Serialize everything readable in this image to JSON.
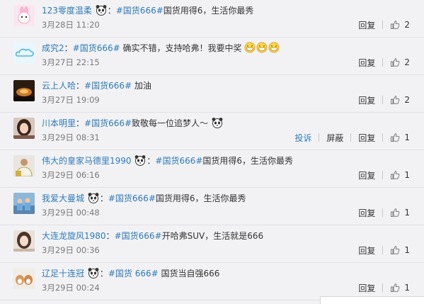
{
  "actions": {
    "reply": "回复",
    "report": "投诉",
    "block": "屏蔽"
  },
  "comments": [
    {
      "user": "123零度温柔",
      "colon": "：",
      "tag": "#国货666#",
      "text": "国货用得6，生活你最秀",
      "time": "3月28日 11:20",
      "likes": "2"
    },
    {
      "user": "成究2",
      "colon": "：",
      "tag": "#国货666#",
      "text": " 确实不错，支持哈弗！我要中奖",
      "time": "3月27日 22:15",
      "likes": "2"
    },
    {
      "user": "云上人哈",
      "colon": "：",
      "tag": "#国货666#",
      "text": " 加油",
      "time": "3月27日 19:09",
      "likes": "2"
    },
    {
      "user": "川本明里",
      "colon": "：",
      "tag": "#国货666#",
      "text": "致敬每一位追梦人～",
      "time": "3月29日 08:31",
      "likes": "1"
    },
    {
      "user": "伟大的皇家马德里1990",
      "colon": "：",
      "tag": "#国货666#",
      "text": "国货用得6，生活你最秀",
      "time": "3月29日 06:16",
      "likes": "1"
    },
    {
      "user": "我爱大曼城",
      "colon": "：",
      "tag": "#国货666#",
      "text": "国货用得6，生活你最秀",
      "time": "3月29日 00:48",
      "likes": "1"
    },
    {
      "user": "大连龙旋风1980",
      "colon": "：",
      "tag": "#国货666#",
      "text": "开哈弗SUV，生活就是666",
      "time": "3月29日 00:36",
      "likes": "1"
    },
    {
      "user": "辽足十连冠",
      "colon": "：",
      "tag": "#国货 666#",
      "text": " 国货当自强666",
      "time": "3月29日 00:24",
      "likes": "1"
    }
  ]
}
